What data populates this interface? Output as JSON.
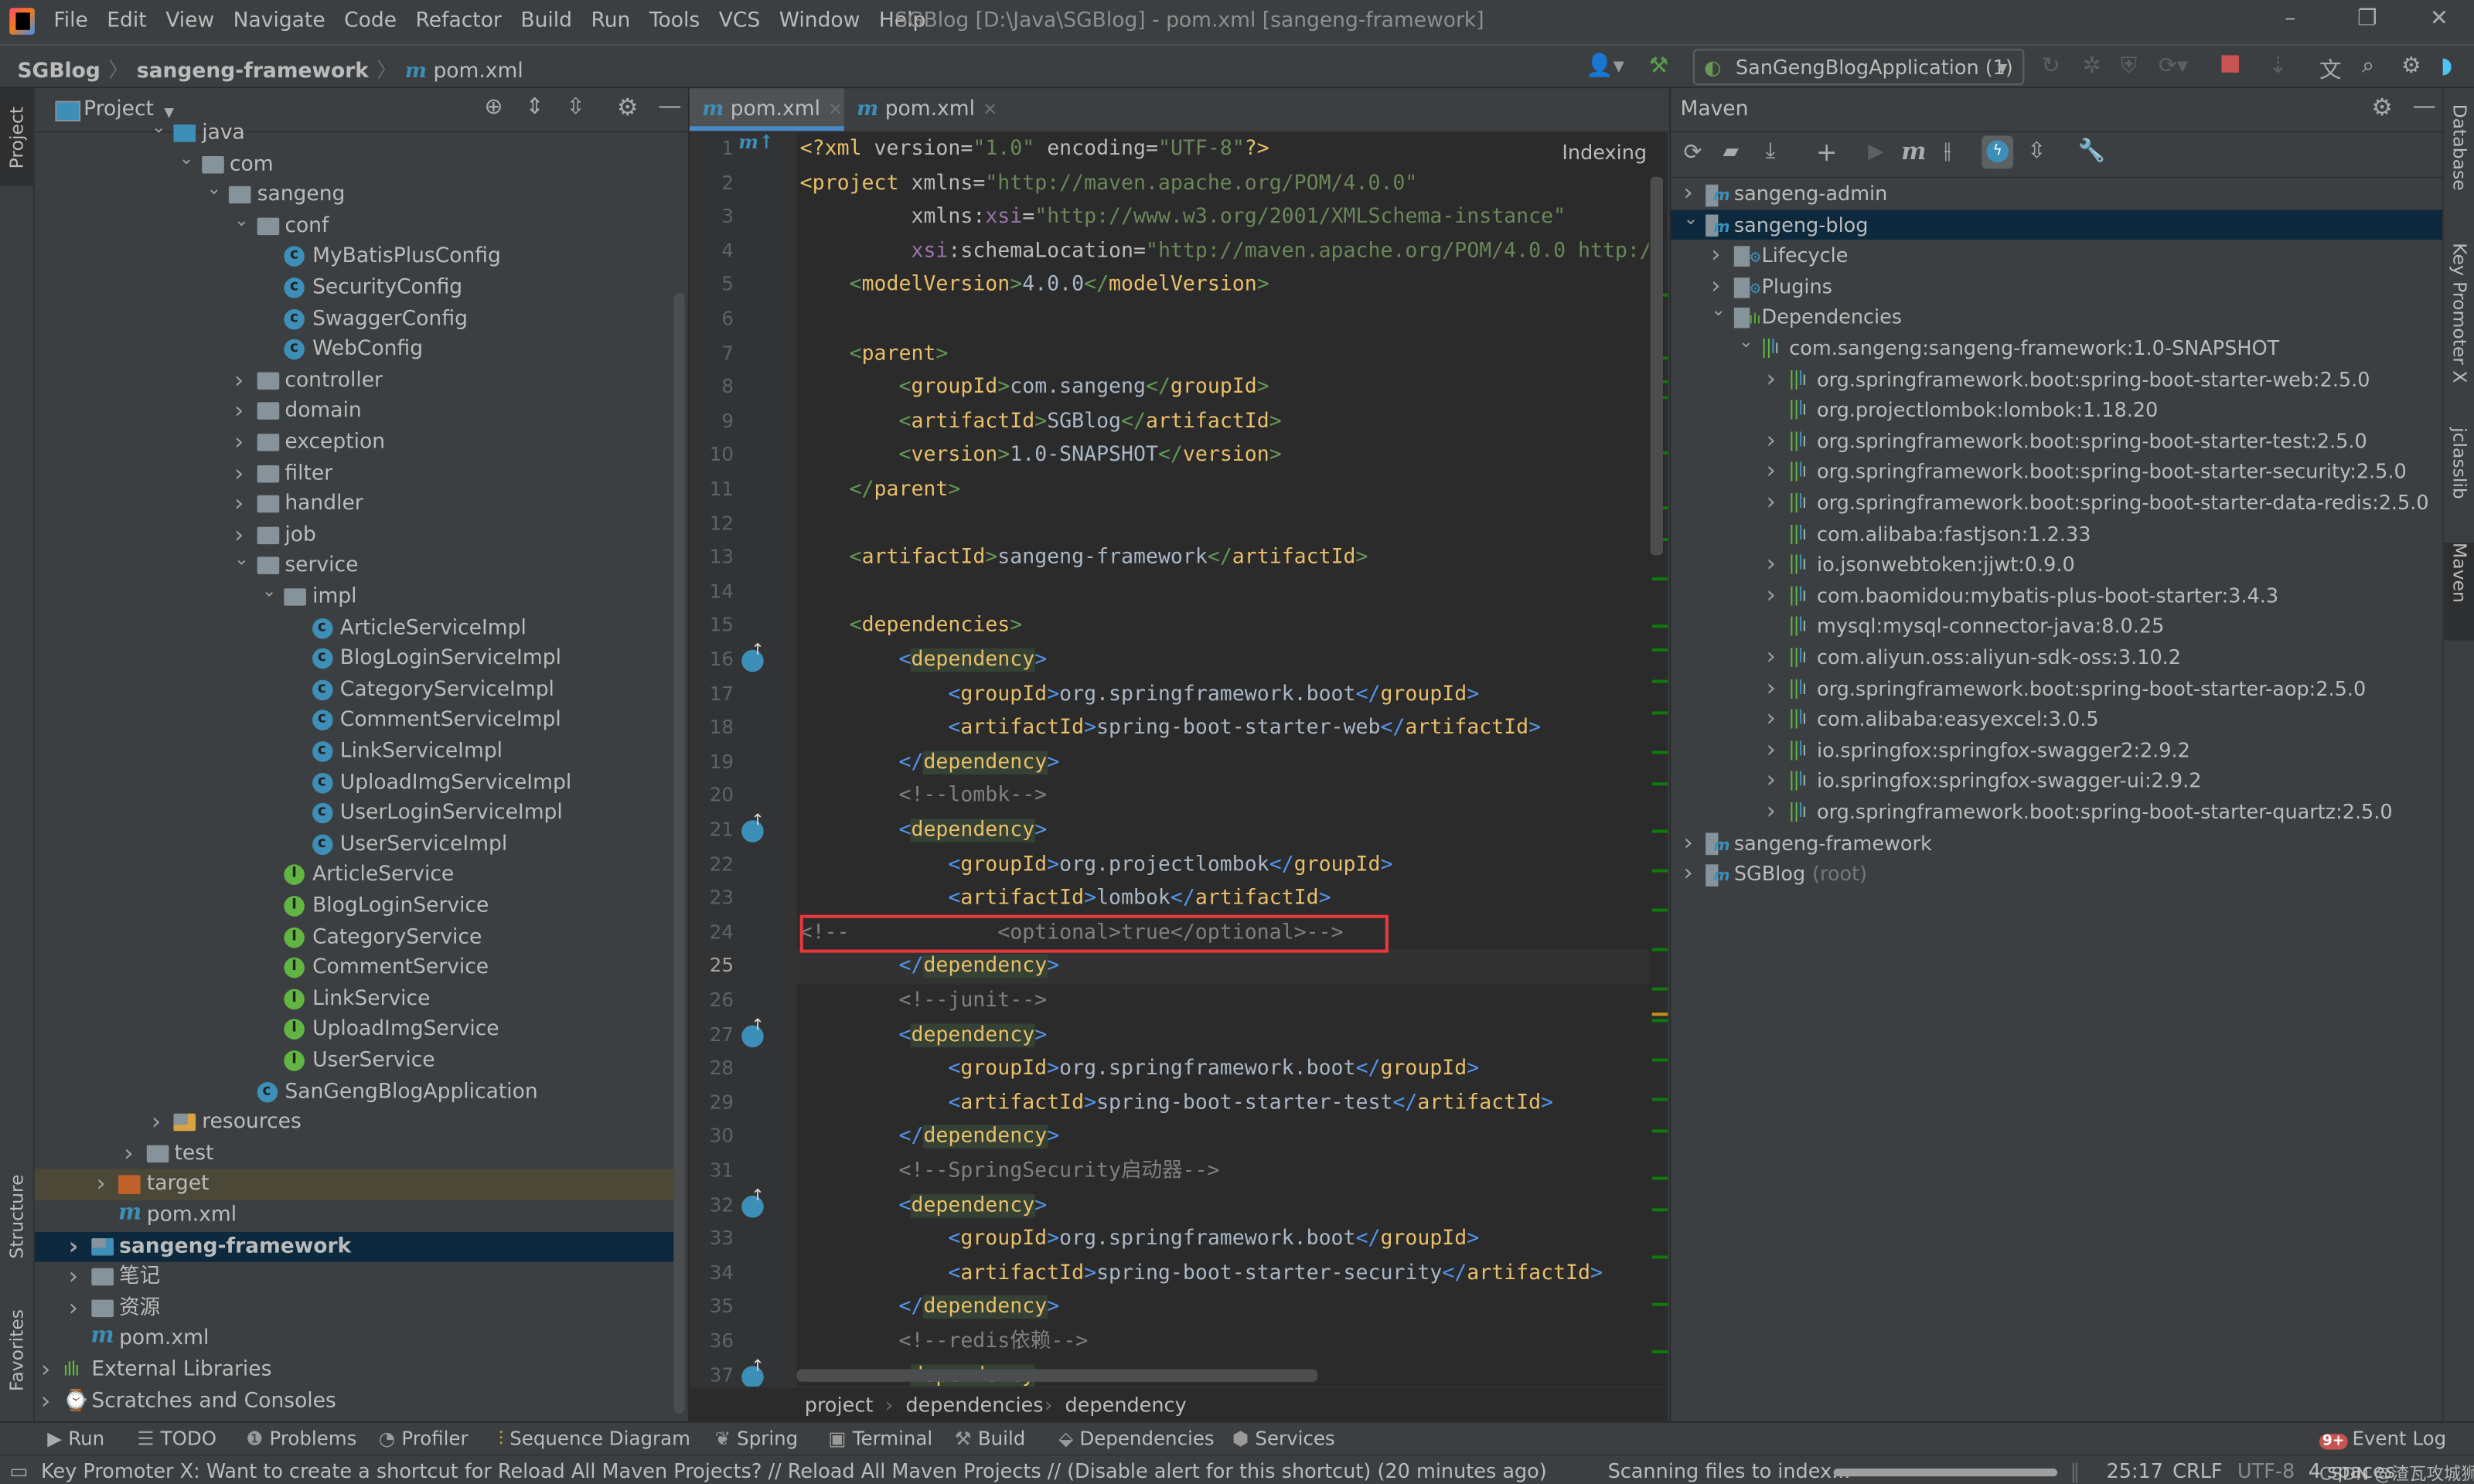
{
  "window": {
    "title": "SGBlog [D:\\Java\\SGBlog] - pom.xml [sangeng-framework]",
    "menu": [
      "File",
      "Edit",
      "View",
      "Navigate",
      "Code",
      "Refactor",
      "Build",
      "Run",
      "Tools",
      "VCS",
      "Window",
      "Help"
    ],
    "controls": {
      "minimize": "–",
      "restore": "❐",
      "close": "✕"
    }
  },
  "navbar": {
    "breadcrumb": [
      "SGBlog",
      "sangeng-framework",
      "pom.xml"
    ],
    "run_config": "SanGengBlogApplication (1)"
  },
  "left_stripe": {
    "tabs": [
      "Project",
      "Structure",
      "Favorites"
    ]
  },
  "right_stripe": {
    "tabs": [
      "Database",
      "Key Promoter X",
      "jclasslib",
      "Maven"
    ]
  },
  "project_panel": {
    "title": "Project",
    "tree": [
      {
        "label": "java",
        "depth": 4,
        "expanded": true,
        "icon": "source-folder-icon"
      },
      {
        "label": "com",
        "depth": 5,
        "expanded": true,
        "icon": "package-icon"
      },
      {
        "label": "sangeng",
        "depth": 6,
        "expanded": true,
        "icon": "package-icon"
      },
      {
        "label": "conf",
        "depth": 7,
        "expanded": true,
        "icon": "package-icon"
      },
      {
        "label": "MyBatisPlusConfig",
        "depth": 8,
        "icon": "class-icon"
      },
      {
        "label": "SecurityConfig",
        "depth": 8,
        "icon": "class-icon"
      },
      {
        "label": "SwaggerConfig",
        "depth": 8,
        "icon": "class-icon"
      },
      {
        "label": "WebConfig",
        "depth": 8,
        "icon": "class-icon"
      },
      {
        "label": "controller",
        "depth": 7,
        "expanded": false,
        "icon": "package-icon"
      },
      {
        "label": "domain",
        "depth": 7,
        "expanded": false,
        "icon": "package-icon"
      },
      {
        "label": "exception",
        "depth": 7,
        "expanded": false,
        "icon": "package-icon"
      },
      {
        "label": "filter",
        "depth": 7,
        "expanded": false,
        "icon": "package-icon"
      },
      {
        "label": "handler",
        "depth": 7,
        "expanded": false,
        "icon": "package-icon"
      },
      {
        "label": "job",
        "depth": 7,
        "expanded": false,
        "icon": "package-icon"
      },
      {
        "label": "service",
        "depth": 7,
        "expanded": true,
        "icon": "package-icon"
      },
      {
        "label": "impl",
        "depth": 8,
        "expanded": true,
        "icon": "package-icon"
      },
      {
        "label": "ArticleServiceImpl",
        "depth": 9,
        "icon": "class-icon"
      },
      {
        "label": "BlogLoginServiceImpl",
        "depth": 9,
        "icon": "class-icon"
      },
      {
        "label": "CategoryServiceImpl",
        "depth": 9,
        "icon": "class-icon"
      },
      {
        "label": "CommentServiceImpl",
        "depth": 9,
        "icon": "class-icon"
      },
      {
        "label": "LinkServiceImpl",
        "depth": 9,
        "icon": "class-icon"
      },
      {
        "label": "UploadImgServiceImpl",
        "depth": 9,
        "icon": "class-icon"
      },
      {
        "label": "UserLoginServiceImpl",
        "depth": 9,
        "icon": "class-icon"
      },
      {
        "label": "UserServiceImpl",
        "depth": 9,
        "icon": "class-icon"
      },
      {
        "label": "ArticleService",
        "depth": 8,
        "icon": "interface-icon"
      },
      {
        "label": "BlogLoginService",
        "depth": 8,
        "icon": "interface-icon"
      },
      {
        "label": "CategoryService",
        "depth": 8,
        "icon": "interface-icon"
      },
      {
        "label": "CommentService",
        "depth": 8,
        "icon": "interface-icon"
      },
      {
        "label": "LinkService",
        "depth": 8,
        "icon": "interface-icon"
      },
      {
        "label": "UploadImgService",
        "depth": 8,
        "icon": "interface-icon"
      },
      {
        "label": "UserService",
        "depth": 8,
        "icon": "interface-icon"
      },
      {
        "label": "SanGengBlogApplication",
        "depth": 7,
        "icon": "class-icon"
      },
      {
        "label": "resources",
        "depth": 4,
        "expanded": false,
        "icon": "resources-folder-icon"
      },
      {
        "label": "test",
        "depth": 3,
        "expanded": false,
        "icon": "folder-icon"
      },
      {
        "label": "target",
        "depth": 2,
        "expanded": false,
        "icon": "excluded-folder-icon",
        "highlight": "excluded"
      },
      {
        "label": "pom.xml",
        "depth": 2,
        "icon": "maven-file-icon"
      },
      {
        "label": "sangeng-framework",
        "depth": 1,
        "expanded": false,
        "icon": "module-folder-icon",
        "selected": true
      },
      {
        "label": "笔记",
        "depth": 1,
        "expanded": false,
        "icon": "folder-icon"
      },
      {
        "label": "资源",
        "depth": 1,
        "expanded": false,
        "icon": "folder-icon"
      },
      {
        "label": "pom.xml",
        "depth": 1,
        "icon": "maven-file-icon"
      },
      {
        "label": "External Libraries",
        "depth": 0,
        "expanded": false,
        "icon": "libraries-icon"
      },
      {
        "label": "Scratches and Consoles",
        "depth": 0,
        "expanded": false,
        "icon": "scratches-icon"
      }
    ]
  },
  "editor": {
    "tabs": [
      {
        "label": "pom.xml",
        "active": true
      },
      {
        "label": "pom.xml",
        "active": false
      }
    ],
    "status_hint": "Indexing...",
    "caret_line": 25,
    "highlighted_line": 24,
    "lines": [
      "<?xml version=\"1.0\" encoding=\"UTF-8\"?>",
      "<project xmlns=\"http://maven.apache.org/POM/4.0.0\"",
      "         xmlns:xsi=\"http://www.w3.org/2001/XMLSchema-instance\"",
      "         xsi:schemaLocation=\"http://maven.apache.org/POM/4.0.0 http://",
      "    <modelVersion>4.0.0</modelVersion>",
      "",
      "    <parent>",
      "        <groupId>com.sangeng</groupId>",
      "        <artifactId>SGBlog</artifactId>",
      "        <version>1.0-SNAPSHOT</version>",
      "    </parent>",
      "",
      "    <artifactId>sangeng-framework</artifactId>",
      "",
      "    <dependencies>",
      "        <dependency>",
      "            <groupId>org.springframework.boot</groupId>",
      "            <artifactId>spring-boot-starter-web</artifactId>",
      "        </dependency>",
      "        <!--lombk-->",
      "        <dependency>",
      "            <groupId>org.projectlombok</groupId>",
      "            <artifactId>lombok</artifactId>",
      "<!--            <optional>true</optional>-->",
      "        </dependency>",
      "        <!--junit-->",
      "        <dependency>",
      "            <groupId>org.springframework.boot</groupId>",
      "            <artifactId>spring-boot-starter-test</artifactId>",
      "        </dependency>",
      "        <!--SpringSecurity启动器-->",
      "        <dependency>",
      "            <groupId>org.springframework.boot</groupId>",
      "            <artifactId>spring-boot-starter-security</artifactId>",
      "        </dependency>",
      "        <!--redis依赖-->",
      "        <dependency>"
    ],
    "breadcrumb": [
      "project",
      "dependencies",
      "dependency"
    ]
  },
  "maven_panel": {
    "title": "Maven",
    "tree": [
      {
        "label": "sangeng-admin",
        "depth": 0,
        "expanded": false,
        "icon": "maven-module-icon"
      },
      {
        "label": "sangeng-blog",
        "depth": 0,
        "expanded": true,
        "icon": "maven-module-icon",
        "selected": true
      },
      {
        "label": "Lifecycle",
        "depth": 1,
        "expanded": false,
        "icon": "lifecycle-folder-icon"
      },
      {
        "label": "Plugins",
        "depth": 1,
        "expanded": false,
        "icon": "plugins-folder-icon"
      },
      {
        "label": "Dependencies",
        "depth": 1,
        "expanded": true,
        "icon": "dependencies-folder-icon"
      },
      {
        "label": "com.sangeng:sangeng-framework:1.0-SNAPSHOT",
        "depth": 2,
        "expanded": true,
        "icon": "library-icon"
      },
      {
        "label": "org.springframework.boot:spring-boot-starter-web:2.5.0",
        "depth": 3,
        "expanded": false,
        "icon": "library-icon"
      },
      {
        "label": "org.projectlombok:lombok:1.18.20",
        "depth": 3,
        "icon": "library-icon"
      },
      {
        "label": "org.springframework.boot:spring-boot-starter-test:2.5.0",
        "depth": 3,
        "expanded": false,
        "icon": "library-icon"
      },
      {
        "label": "org.springframework.boot:spring-boot-starter-security:2.5.0",
        "depth": 3,
        "expanded": false,
        "icon": "library-icon"
      },
      {
        "label": "org.springframework.boot:spring-boot-starter-data-redis:2.5.0",
        "depth": 3,
        "expanded": false,
        "icon": "library-icon"
      },
      {
        "label": "com.alibaba:fastjson:1.2.33",
        "depth": 3,
        "icon": "library-icon"
      },
      {
        "label": "io.jsonwebtoken:jjwt:0.9.0",
        "depth": 3,
        "expanded": false,
        "icon": "library-icon"
      },
      {
        "label": "com.baomidou:mybatis-plus-boot-starter:3.4.3",
        "depth": 3,
        "expanded": false,
        "icon": "library-icon"
      },
      {
        "label": "mysql:mysql-connector-java:8.0.25",
        "depth": 3,
        "icon": "library-icon"
      },
      {
        "label": "com.aliyun.oss:aliyun-sdk-oss:3.10.2",
        "depth": 3,
        "expanded": false,
        "icon": "library-icon"
      },
      {
        "label": "org.springframework.boot:spring-boot-starter-aop:2.5.0",
        "depth": 3,
        "expanded": false,
        "icon": "library-icon"
      },
      {
        "label": "com.alibaba:easyexcel:3.0.5",
        "depth": 3,
        "expanded": false,
        "icon": "library-icon"
      },
      {
        "label": "io.springfox:springfox-swagger2:2.9.2",
        "depth": 3,
        "expanded": false,
        "icon": "library-icon"
      },
      {
        "label": "io.springfox:springfox-swagger-ui:2.9.2",
        "depth": 3,
        "expanded": false,
        "icon": "library-icon"
      },
      {
        "label": "org.springframework.boot:spring-boot-starter-quartz:2.5.0",
        "depth": 3,
        "expanded": false,
        "icon": "library-icon"
      },
      {
        "label": "sangeng-framework",
        "depth": 0,
        "expanded": false,
        "icon": "maven-module-icon"
      },
      {
        "label": "SGBlog",
        "suffix": "(root)",
        "depth": 0,
        "expanded": false,
        "icon": "maven-module-icon"
      }
    ]
  },
  "bottom_tools": [
    {
      "label": "Run",
      "icon": "run-icon"
    },
    {
      "label": "TODO",
      "icon": "todo-icon"
    },
    {
      "label": "Problems",
      "icon": "problems-icon"
    },
    {
      "label": "Profiler",
      "icon": "profiler-icon"
    },
    {
      "label": "Sequence Diagram",
      "icon": "sequence-diagram-icon"
    },
    {
      "label": "Spring",
      "icon": "spring-icon"
    },
    {
      "label": "Terminal",
      "icon": "terminal-icon"
    },
    {
      "label": "Build",
      "icon": "build-icon"
    },
    {
      "label": "Dependencies",
      "icon": "dependencies-icon"
    },
    {
      "label": "Services",
      "icon": "services-icon"
    }
  ],
  "event_log": {
    "label": "Event Log",
    "badge": "9+"
  },
  "status": {
    "message": "Key Promoter X: Want to create a shortcut for Reload All Maven Projects? // Reload All Maven Projects // (Disable alert for this shortcut) (20 minutes ago)",
    "task": "Scanning files to index...",
    "task_progress_percent": 100,
    "caret": "25:17",
    "line_sep": "CRLF",
    "encoding": "UTF-8",
    "indent": "4 spaces",
    "watermark": "CSDN @渣瓦攻城狮"
  },
  "colors": {
    "accent": "#4a88c7",
    "selection": "#0d293e",
    "highlight_box": "#e8383b",
    "tag": "#e8bf6a",
    "string": "#6a8759",
    "comment": "#808080"
  }
}
